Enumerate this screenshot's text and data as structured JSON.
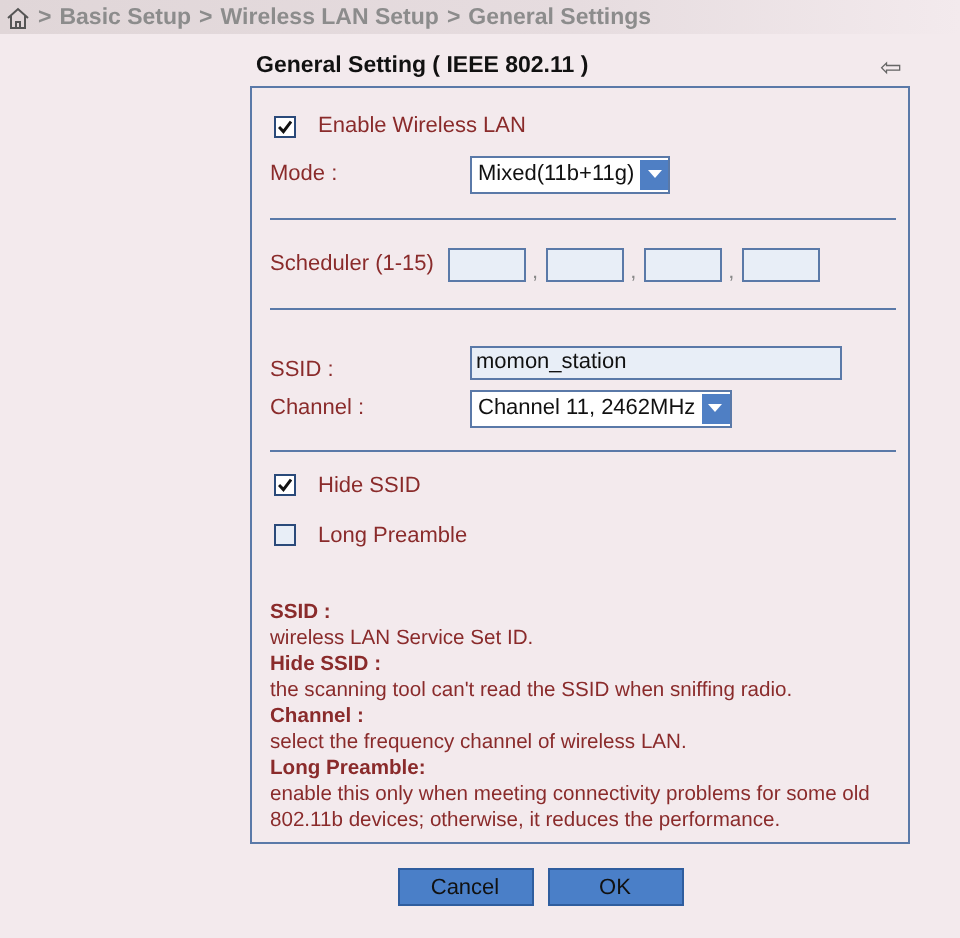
{
  "breadcrumb": {
    "separator": ">",
    "items": [
      "Basic Setup",
      "Wireless LAN Setup",
      "General Settings"
    ]
  },
  "panel": {
    "title": "General Setting ( IEEE 802.11 )",
    "back_glyph": "⇦"
  },
  "enable_wireless": {
    "label": "Enable Wireless LAN",
    "checked": true
  },
  "mode": {
    "label": "Mode :",
    "value": "Mixed(11b+11g)"
  },
  "scheduler": {
    "label": "Scheduler (1-15)",
    "separator": ",",
    "fields": [
      {
        "kind": "text"
      },
      {
        "kind": "text"
      },
      {
        "kind": "text"
      },
      {
        "kind": "text"
      }
    ]
  },
  "ssid": {
    "label": "SSID :",
    "value": "momon_station"
  },
  "channel": {
    "label": "Channel :",
    "value": "Channel 11, 2462MHz"
  },
  "options": [
    {
      "label": "Hide SSID",
      "checked": true
    },
    {
      "label": "Long Preamble",
      "checked": false
    }
  ],
  "help": [
    {
      "term": "SSID :",
      "text": "wireless LAN Service Set ID."
    },
    {
      "term": "Hide SSID :",
      "text": "the scanning tool can't read the SSID when sniffing radio."
    },
    {
      "term": "Channel :",
      "text": "select the frequency channel of wireless LAN."
    },
    {
      "term": "Long Preamble:",
      "text": "enable this only when meeting connectivity problems for some old 802.11b devices; otherwise, it reduces the performance."
    }
  ],
  "buttons": [
    "Cancel",
    "OK"
  ]
}
